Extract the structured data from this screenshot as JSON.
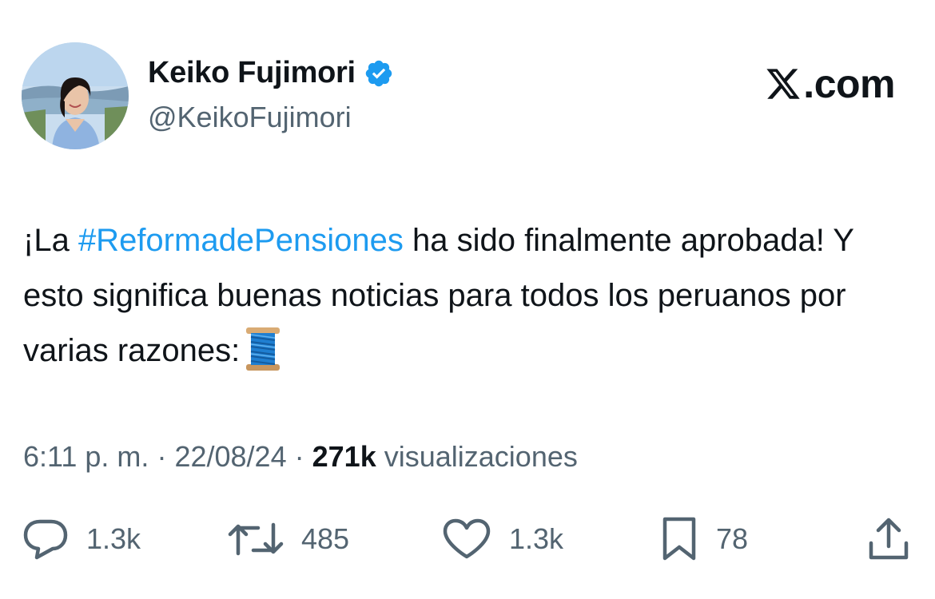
{
  "author": {
    "display_name": "Keiko Fujimori",
    "handle": "@KeikoFujimori",
    "verified": true
  },
  "brand": {
    "logo_icon": "x-logo-icon",
    "domain_text": ".com"
  },
  "tweet": {
    "text_before": "¡La ",
    "hashtag": "#ReformadePensiones",
    "text_after": " ha sido finalmente aprobada! Y esto significa buenas noticias para todos los peruanos por varias razones:",
    "emoji_icon": "thread-spool-icon"
  },
  "meta": {
    "time": "6:11 p. m.",
    "separator": "·",
    "date": "22/08/24",
    "views_count": "271k",
    "views_label": "visualizaciones"
  },
  "actions": {
    "replies": "1.3k",
    "reposts": "485",
    "likes": "1.3k",
    "bookmarks": "78"
  },
  "colors": {
    "text": "#0f1419",
    "secondary": "#536471",
    "accent": "#1d9bf0"
  }
}
